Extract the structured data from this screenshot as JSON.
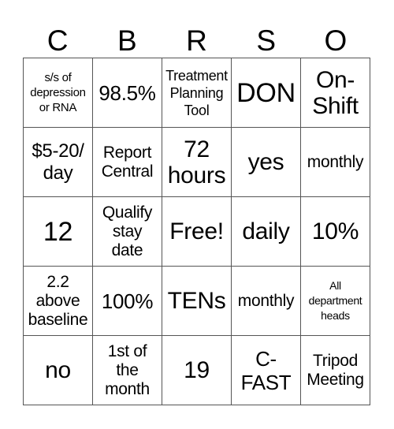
{
  "header": {
    "letters": [
      "C",
      "B",
      "R",
      "S",
      "O"
    ]
  },
  "board": {
    "rows": [
      [
        "s/s of\ndepression\nor RNA",
        "98.5%",
        "Treatment\nPlanning\nTool",
        "DON",
        "On-\nShift"
      ],
      [
        "$5-20/\nday",
        "Report\nCentral",
        "72\nhours",
        "yes",
        "monthly"
      ],
      [
        "12",
        "Qualify\nstay\ndate",
        "Free!",
        "daily",
        "10%"
      ],
      [
        "2.2\nabove\nbaseline",
        "100%",
        "TENs",
        "monthly",
        "All\ndepartment\nheads"
      ],
      [
        "no",
        "1st of\nthe\nmonth",
        "19",
        "C-\nFAST",
        "Tripod\nMeeting"
      ]
    ]
  }
}
